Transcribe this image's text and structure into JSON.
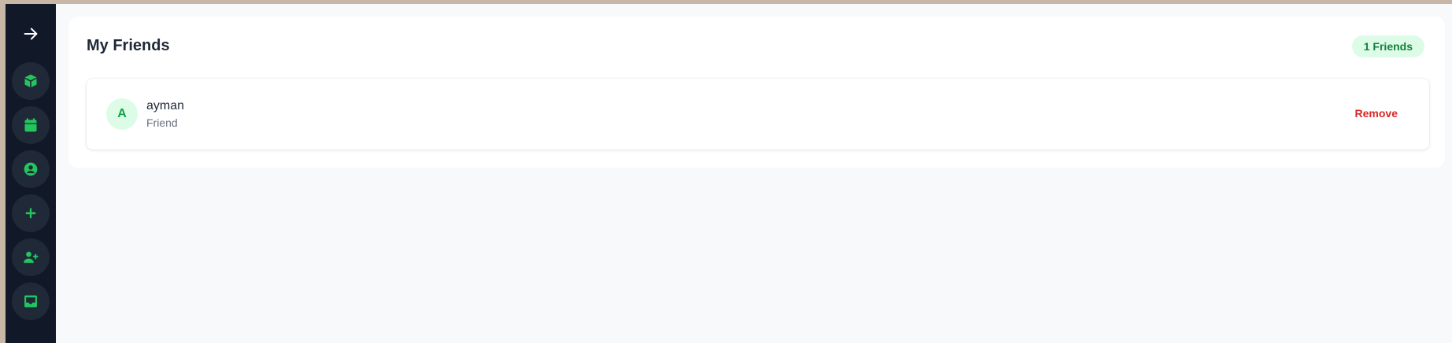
{
  "sidebar": {
    "toggle_icon": "arrow-right-icon",
    "items": [
      {
        "icon": "cube-icon"
      },
      {
        "icon": "calendar-icon"
      },
      {
        "icon": "user-circle-icon"
      },
      {
        "icon": "plus-icon"
      },
      {
        "icon": "user-plus-icon"
      },
      {
        "icon": "inbox-icon"
      }
    ]
  },
  "main": {
    "title": "My Friends",
    "badge": "1 Friends",
    "friends": [
      {
        "initial": "A",
        "name": "ayman",
        "status": "Friend",
        "action": "Remove"
      }
    ]
  },
  "colors": {
    "sidebar_bg": "#111827",
    "icon_accent": "#22c55e",
    "badge_bg": "#dcfce7",
    "badge_text": "#15803d",
    "remove_text": "#dc2626"
  }
}
